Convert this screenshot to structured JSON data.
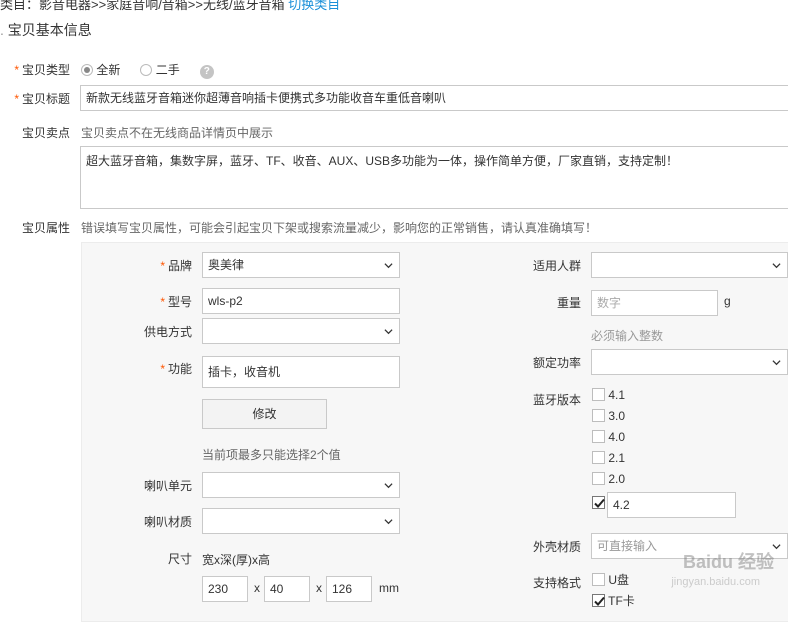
{
  "breadcrumb": {
    "prefix": "类目：影音电器>>",
    "mid": "家庭音响/音箱>>无线/蓝牙音箱",
    "link": "切换类目"
  },
  "section_title": "宝贝基本信息",
  "type_row": {
    "label": "宝贝类型",
    "options": [
      "全新",
      "二手"
    ],
    "selected": "全新",
    "help": "?"
  },
  "title_row": {
    "label": "宝贝标题",
    "value": "新款无线蓝牙音箱迷你超薄音响插卡便携式多功能收音车重低音喇叭"
  },
  "selling_point": {
    "label": "宝贝卖点",
    "hint": "宝贝卖点不在无线商品详情页中展示",
    "value": "超大蓝牙音箱，集数字屏，蓝牙、TF、收音、AUX、USB多功能为一体，操作简单方便，厂家直销，支持定制！"
  },
  "attributes": {
    "label": "宝贝属性",
    "warning": "错误填写宝贝属性，可能会引起宝贝下架或搜索流量减少，影响您的正常销售，请认真准确填写！",
    "left": {
      "brand": {
        "label": "品牌",
        "value": "奥美律"
      },
      "model": {
        "label": "型号",
        "value": "wls-p2"
      },
      "power_supply": {
        "label": "供电方式",
        "value": ""
      },
      "function": {
        "label": "功能",
        "value": "插卡，收音机"
      },
      "modify_button": "修改",
      "function_hint": "当前项最多只能选择2个值",
      "speaker_unit": {
        "label": "喇叭单元",
        "value": ""
      },
      "speaker_material": {
        "label": "喇叭材质",
        "value": ""
      },
      "size": {
        "label": "尺寸",
        "hint": "宽x深(厚)x高",
        "width": "230",
        "depth": "40",
        "height": "126",
        "sep": "x",
        "unit": "mm"
      }
    },
    "right": {
      "audience": {
        "label": "适用人群",
        "value": ""
      },
      "weight": {
        "label": "重量",
        "placeholder": "数字",
        "unit": "g",
        "hint": "必须输入整数"
      },
      "rated_power": {
        "label": "额定功率",
        "value": ""
      },
      "bluetooth": {
        "label": "蓝牙版本",
        "options": [
          "4.1",
          "3.0",
          "4.0",
          "2.1",
          "2.0"
        ],
        "other_value": "4.2"
      },
      "shell_material": {
        "label": "外壳材质",
        "placeholder": "可直接输入"
      },
      "formats": {
        "label": "支持格式",
        "options": [
          "U盘",
          "TF卡"
        ]
      }
    }
  },
  "watermark": {
    "text": "Baidu 经验",
    "url_text": "jingyan.baidu.com"
  }
}
